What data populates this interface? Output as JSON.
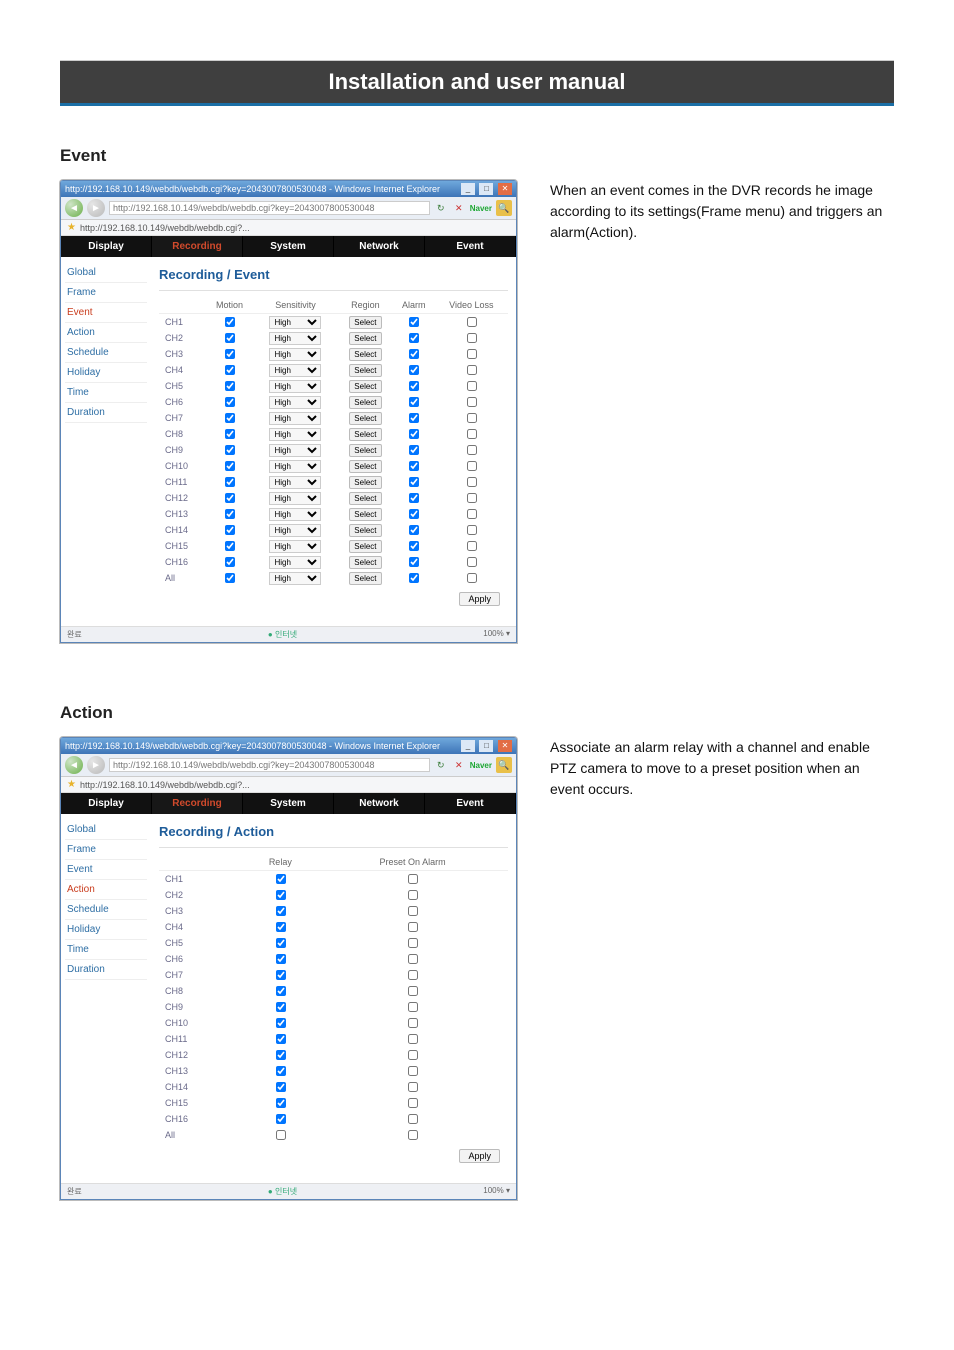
{
  "document": {
    "page_title": "Installation and user manual",
    "sections": {
      "event": {
        "heading": "Event",
        "description": "When an event comes in the DVR records he image according to its settings(Frame menu) and triggers an alarm(Action)."
      },
      "action": {
        "heading": "Action",
        "description": "Associate an alarm relay with a channel and enable PTZ camera to move to a preset position when an event occurs."
      }
    }
  },
  "browser": {
    "title": "http://192.168.10.149/webdb/webdb.cgi?key=2043007800530048 - Windows Internet Explorer",
    "url": "http://192.168.10.149/webdb/webdb.cgi?key=2043007800530048",
    "tab_label": "http://192.168.10.149/webdb/webdb.cgi?...",
    "refresh_icon": "↻",
    "close_icon": "✕",
    "search_engine": "Naver",
    "status_done": "완료",
    "status_internet": "인터넷",
    "zoom": "100%"
  },
  "main_tabs": [
    "Display",
    "Recording",
    "System",
    "Network",
    "Event"
  ],
  "sidebar_items": [
    "Global",
    "Frame",
    "Event",
    "Action",
    "Schedule",
    "Holiday",
    "Time",
    "Duration"
  ],
  "event_panel": {
    "title": "Recording / Event",
    "headers": [
      "",
      "Motion",
      "Sensitivity",
      "Region",
      "Alarm",
      "Video Loss"
    ],
    "sensitivity_value": "High",
    "region_button": "Select",
    "apply": "Apply",
    "channels": [
      "CH1",
      "CH2",
      "CH3",
      "CH4",
      "CH5",
      "CH6",
      "CH7",
      "CH8",
      "CH9",
      "CH10",
      "CH11",
      "CH12",
      "CH13",
      "CH14",
      "CH15",
      "CH16",
      "All"
    ]
  },
  "action_panel": {
    "title": "Recording / Action",
    "headers": [
      "",
      "Relay",
      "Preset On Alarm"
    ],
    "apply": "Apply",
    "channels": [
      "CH1",
      "CH2",
      "CH3",
      "CH4",
      "CH5",
      "CH6",
      "CH7",
      "CH8",
      "CH9",
      "CH10",
      "CH11",
      "CH12",
      "CH13",
      "CH14",
      "CH15",
      "CH16",
      "All"
    ]
  }
}
